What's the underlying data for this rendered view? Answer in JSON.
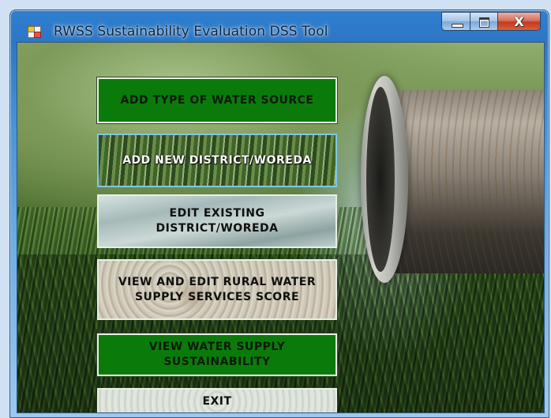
{
  "window": {
    "title": "RWSS Sustainability Evaluation DSS Tool",
    "controls": {
      "minimize_icon": "minimize-icon",
      "maximize_icon": "maximize-icon",
      "close_symbol": "X"
    }
  },
  "menu": {
    "buttons": [
      {
        "label": "ADD TYPE OF WATER SOURCE",
        "style": "green",
        "color": "#0a7b0a"
      },
      {
        "label": "ADD NEW DISTRICT/WOREDA",
        "style": "grass-photo",
        "focused": true
      },
      {
        "label": "EDIT EXISTING DISTRICT/WOREDA",
        "style": "water-photo"
      },
      {
        "label": "VIEW AND EDIT RURAL WATER SUPPLY SERVICES SCORE",
        "style": "stone-photo"
      },
      {
        "label": "VIEW WATER SUPPLY SUSTAINABILITY",
        "style": "green",
        "color": "#0a7b0a"
      },
      {
        "label": "EXIT",
        "style": "light-photo"
      }
    ]
  },
  "colors": {
    "titlebar": "#2d76c5",
    "close_button": "#c13b1f",
    "green_button": "#0a7b0a",
    "focus_border": "#7fc6ea"
  }
}
